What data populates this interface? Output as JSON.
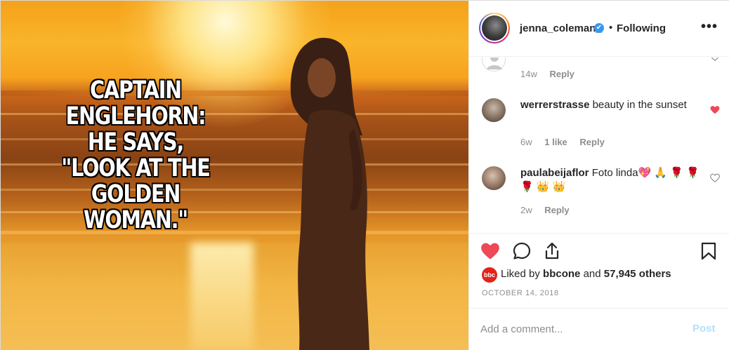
{
  "meme": {
    "lines": [
      "CAPTAIN",
      "ENGLEHORN:",
      "HE SAYS,",
      "\"LOOK AT THE",
      "GOLDEN WOMAN.\""
    ]
  },
  "header": {
    "username": "jenna_coleman_",
    "verified_glyph": "✔",
    "separator": "•",
    "follow_status": "Following",
    "more_glyph": "•••"
  },
  "comments": [
    {
      "username": "",
      "text": "",
      "time": "14w",
      "likes": "",
      "reply_label": "Reply",
      "liked": false
    },
    {
      "username": "werrerstrasse",
      "text": "beauty in the sunset",
      "time": "6w",
      "likes": "1 like",
      "reply_label": "Reply",
      "liked": true
    },
    {
      "username": "paulabeijaflor",
      "text": "Foto linda💖 🙏 🌹 🌹 🌹 👑 👑",
      "time": "2w",
      "likes": "",
      "reply_label": "Reply",
      "liked": false
    }
  ],
  "actions": {
    "liked": true,
    "icons": [
      "heart-icon",
      "comment-icon",
      "share-icon",
      "bookmark-icon"
    ],
    "badge_text": "bbc one",
    "liked_by_prefix": "Liked by",
    "liked_by_user": "bbcone",
    "liked_by_and": "and",
    "liked_by_count": "57,945 others",
    "date": "OCTOBER 14, 2018"
  },
  "add_comment": {
    "placeholder": "Add a comment...",
    "post_label": "Post"
  },
  "colors": {
    "heart_red": "#ed4956",
    "verified_blue": "#3897f0",
    "muted": "#8e8e8e",
    "post_disabled": "#b2dffc"
  }
}
